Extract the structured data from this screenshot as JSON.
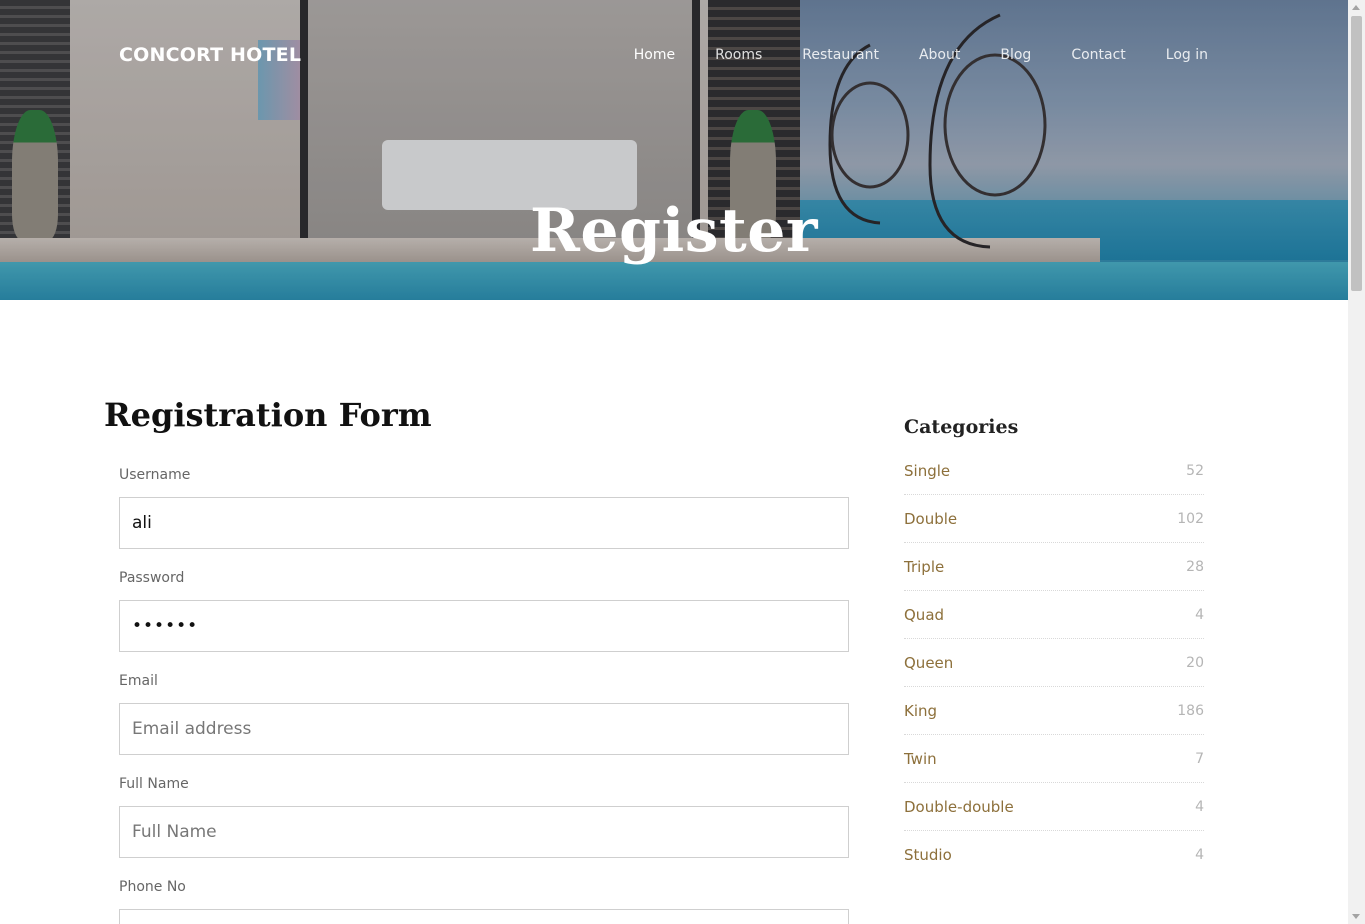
{
  "header": {
    "brand": "CONCORT HOTEL",
    "nav": [
      "Home",
      "Rooms",
      "Restaurant",
      "About",
      "Blog",
      "Contact",
      "Log in"
    ],
    "active_nav": "Home"
  },
  "hero": {
    "title": "Register"
  },
  "form": {
    "title": "Registration Form",
    "fields": [
      {
        "label": "Username",
        "value": "ali",
        "placeholder": ""
      },
      {
        "label": "Password",
        "value": "••••••",
        "placeholder": ""
      },
      {
        "label": "Email",
        "value": "",
        "placeholder": "Email address"
      },
      {
        "label": "Full Name",
        "value": "",
        "placeholder": "Full Name"
      },
      {
        "label": "Phone No",
        "value": "",
        "placeholder": ""
      }
    ]
  },
  "sidebar": {
    "title": "Categories",
    "categories": [
      {
        "name": "Single",
        "count": "52"
      },
      {
        "name": "Double",
        "count": "102"
      },
      {
        "name": "Triple",
        "count": "28"
      },
      {
        "name": "Quad",
        "count": "4"
      },
      {
        "name": "Queen",
        "count": "20"
      },
      {
        "name": "King",
        "count": "186"
      },
      {
        "name": "Twin",
        "count": "7"
      },
      {
        "name": "Double-double",
        "count": "4"
      },
      {
        "name": "Studio",
        "count": "4"
      }
    ]
  },
  "colors": {
    "category_link": "#8d703b",
    "count": "#b5b5b5",
    "input_border": "#cfcfcf"
  }
}
